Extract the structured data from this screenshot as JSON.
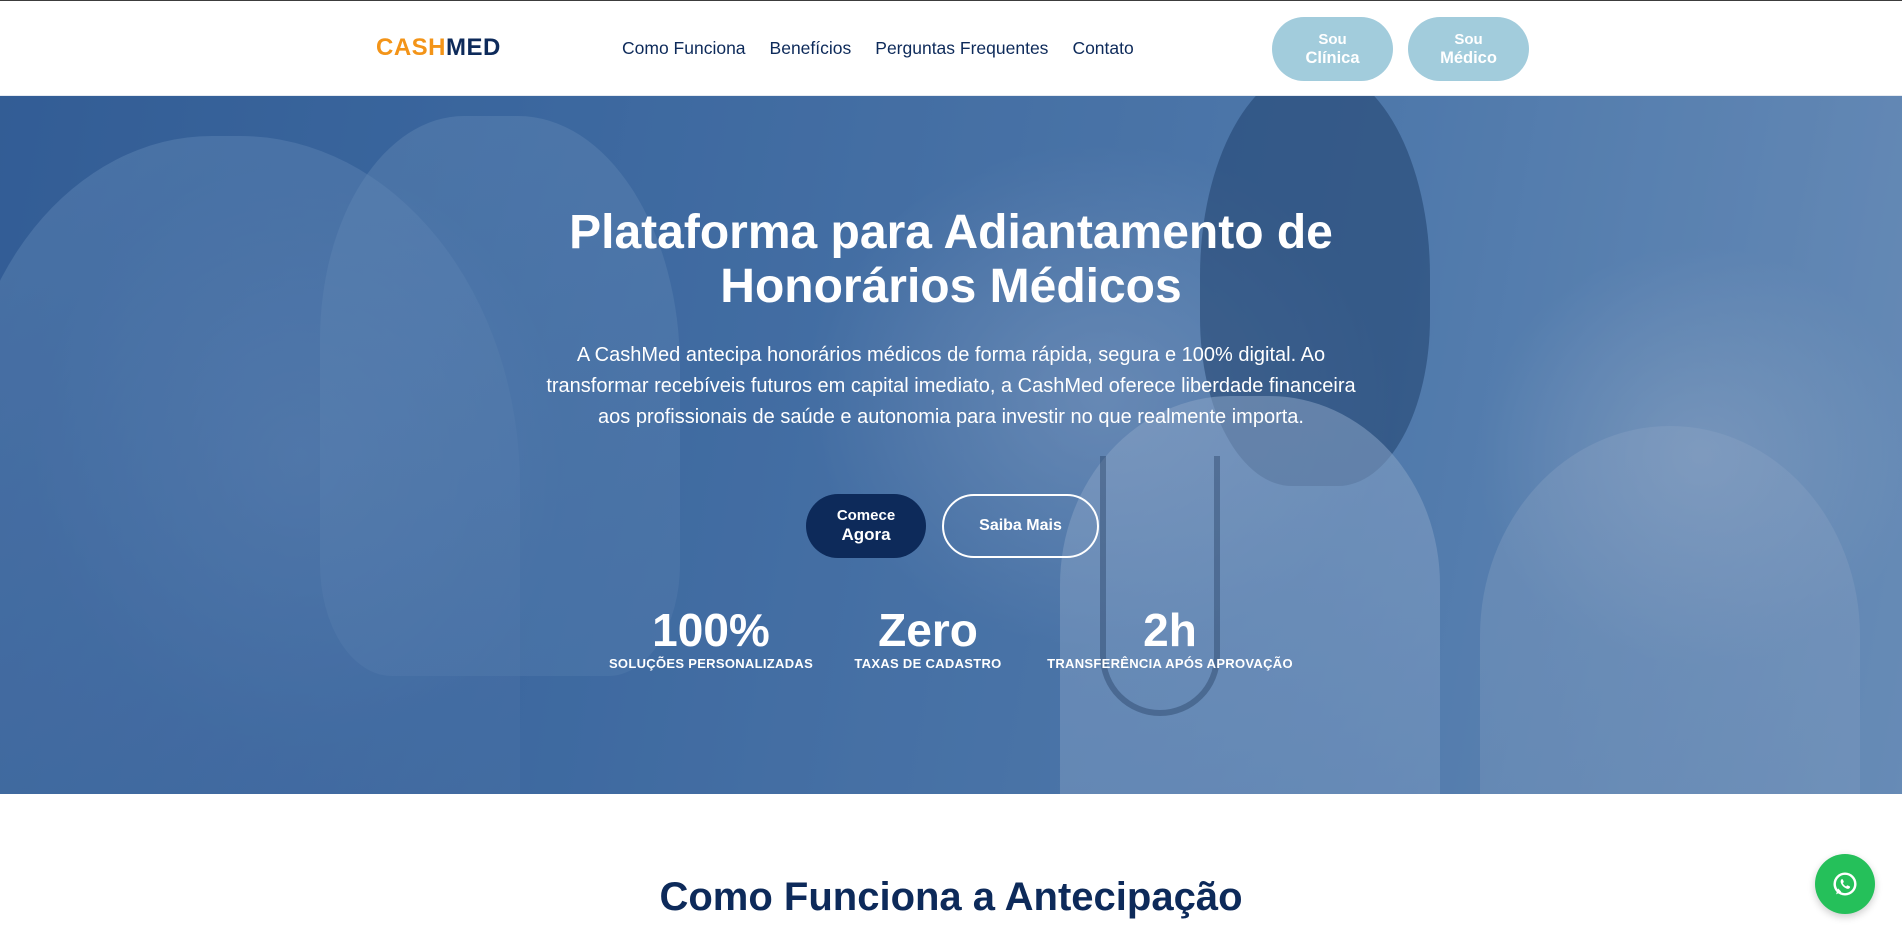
{
  "header": {
    "logo": {
      "part1": "CASH",
      "part2": "MED"
    },
    "nav": [
      {
        "label": "Como Funciona"
      },
      {
        "label": "Benefícios"
      },
      {
        "label": "Perguntas Frequentes"
      },
      {
        "label": "Contato"
      }
    ],
    "buttons": [
      {
        "small": "Sou",
        "big": "Clínica"
      },
      {
        "small": "Sou",
        "big": "Médico"
      }
    ]
  },
  "hero": {
    "title_line1": "Plataforma para Adiantamento de",
    "title_line2": "Honorários Médicos",
    "subtitle": "A CashMed antecipa honorários médicos de forma rápida, segura e 100% digital. Ao transformar recebíveis futuros em capital imediato, a CashMed oferece liberdade financeira aos profissionais de saúde e autonomia para investir no que realmente importa.",
    "cta_start": {
      "small": "Comece",
      "big": "Agora"
    },
    "cta_more": "Saiba Mais",
    "stats": [
      {
        "value": "100%",
        "label": "SOLUÇÕES PERSONALIZADAS"
      },
      {
        "value": "Zero",
        "label": "TAXAS DE CADASTRO"
      },
      {
        "value": "2h",
        "label": "TRANSFERÊNCIA APÓS APROVAÇÃO"
      }
    ]
  },
  "how_it_works": {
    "title": "Como Funciona a Antecipação"
  },
  "whatsapp": {
    "icon": "whatsapp-icon"
  },
  "colors": {
    "brand_orange": "#f39418",
    "brand_navy": "#0d2a5a",
    "header_button": "#a2ccdc",
    "whatsapp_green": "#25c05a"
  }
}
